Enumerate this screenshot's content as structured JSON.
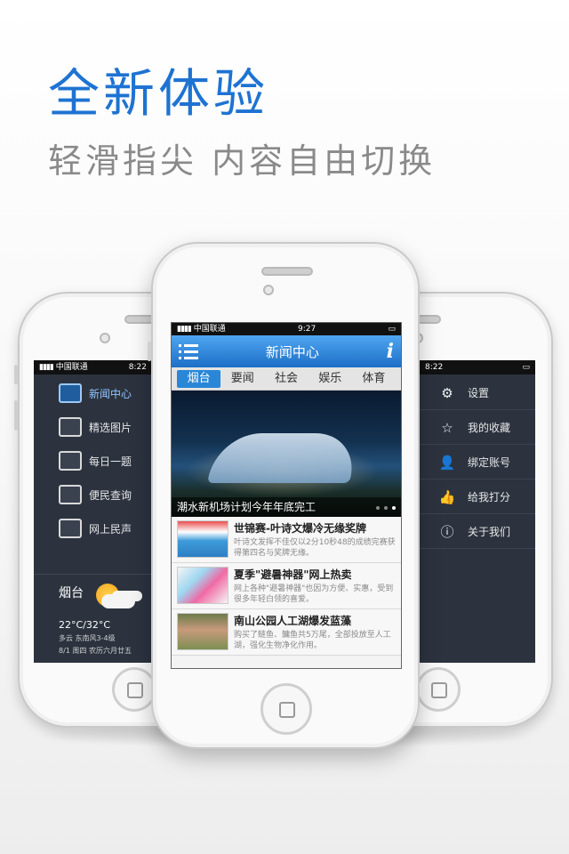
{
  "headline": "全新体验",
  "subline": "轻滑指尖  内容自由切换",
  "left_phone": {
    "status": {
      "carrier": "中国联通",
      "time": "8:22"
    },
    "menu": [
      {
        "label": "新闻中心",
        "icon": "news-icon"
      },
      {
        "label": "精选图片",
        "icon": "picture-icon"
      },
      {
        "label": "每日一题",
        "icon": "chat-icon"
      },
      {
        "label": "便民查询",
        "icon": "grid-icon"
      },
      {
        "label": "网上民声",
        "icon": "people-icon"
      }
    ],
    "weather": {
      "city": "烟台",
      "temp": "22°C/32°C",
      "condition": "多云 东南风3-4级",
      "date": "8/1 周四 农历六月廿五"
    }
  },
  "center_phone": {
    "status": {
      "carrier": "中国联通",
      "time": "9:27"
    },
    "nav_title": "新闻中心",
    "tabs": [
      "烟台",
      "要闻",
      "社会",
      "娱乐",
      "体育"
    ],
    "hero_caption": "潮水新机场计划今年年底完工",
    "news": [
      {
        "title": "世锦赛-叶诗文爆冷无缘奖牌",
        "desc": "叶诗文发挥不佳仅以2分10秒48的成绩完赛获得第四名与奖牌无缘。"
      },
      {
        "title": "夏季\"避暑神器\"网上热卖",
        "desc": "网上各种\"避暑神器\"也因为方便、实惠，受到很多年轻白领的喜爱。"
      },
      {
        "title": "南山公园人工湖爆发蓝藻",
        "desc": "购买了鲢鱼、鳙鱼共5万尾，全部投放至人工湖，强化生物净化作用。"
      }
    ]
  },
  "right_phone": {
    "status": {
      "time": "8:22"
    },
    "menu": [
      {
        "label": "设置",
        "icon": "gear-icon",
        "glyph": "⚙"
      },
      {
        "label": "我的收藏",
        "icon": "star-icon",
        "glyph": "☆"
      },
      {
        "label": "绑定账号",
        "icon": "add-user-icon",
        "glyph": "👤"
      },
      {
        "label": "给我打分",
        "icon": "thumbs-up-icon",
        "glyph": "👍"
      },
      {
        "label": "关于我们",
        "icon": "info-icon",
        "glyph": "ⓘ"
      }
    ]
  },
  "colors": {
    "accent": "#1e73d2",
    "subtitle": "#8a8a8a",
    "sidebar_bg": "#2c333f",
    "nav_blue": "#2a86d6"
  }
}
